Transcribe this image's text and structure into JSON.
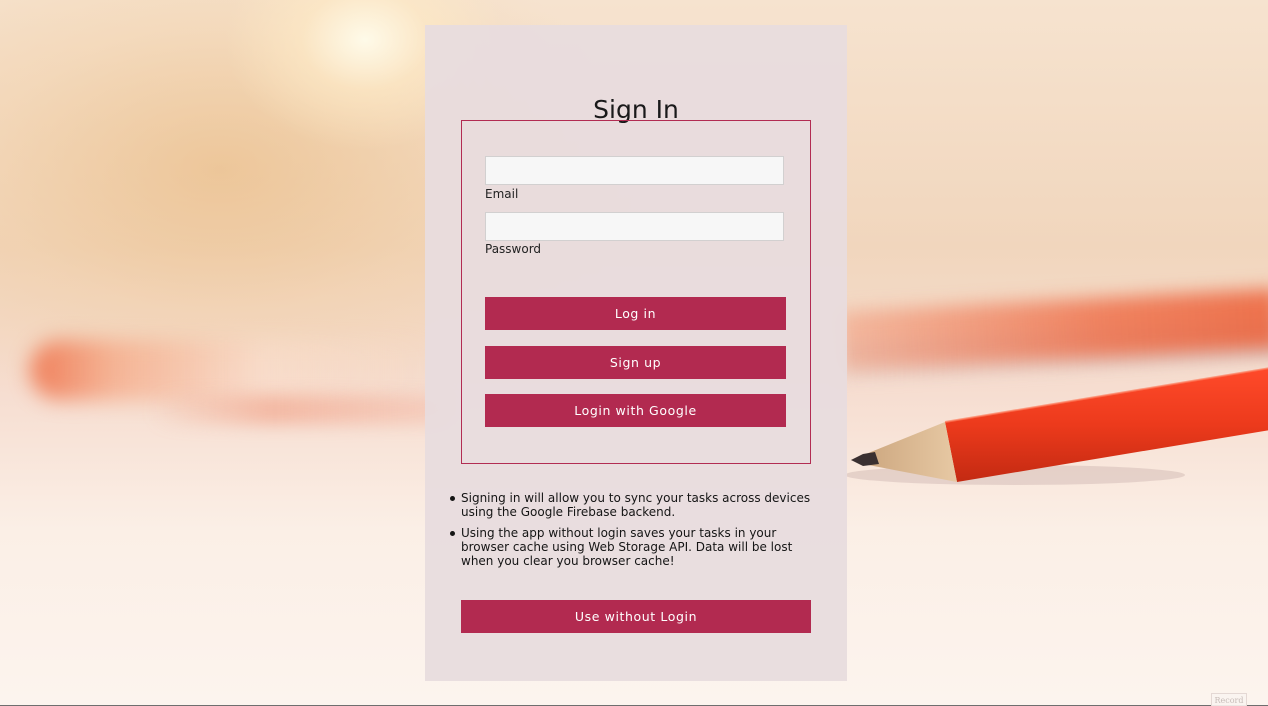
{
  "title": "Sign In",
  "form": {
    "email_value": "",
    "email_label": "Email",
    "password_value": "",
    "password_label": "Password",
    "login_button": "Log in",
    "signup_button": "Sign up",
    "google_button": "Login with Google"
  },
  "notes": [
    "Signing in will allow you to sync your tasks across devices using the Google Firebase backend.",
    "Using the app without login saves your tasks in your browser cache using Web Storage API. Data will be lost when you clear you browser cache!"
  ],
  "guest_button": "Use without Login",
  "record_badge": "Record",
  "colors": {
    "accent": "#b22a50",
    "panel": "#e8dcde",
    "input_bg": "#f7f7f7"
  }
}
